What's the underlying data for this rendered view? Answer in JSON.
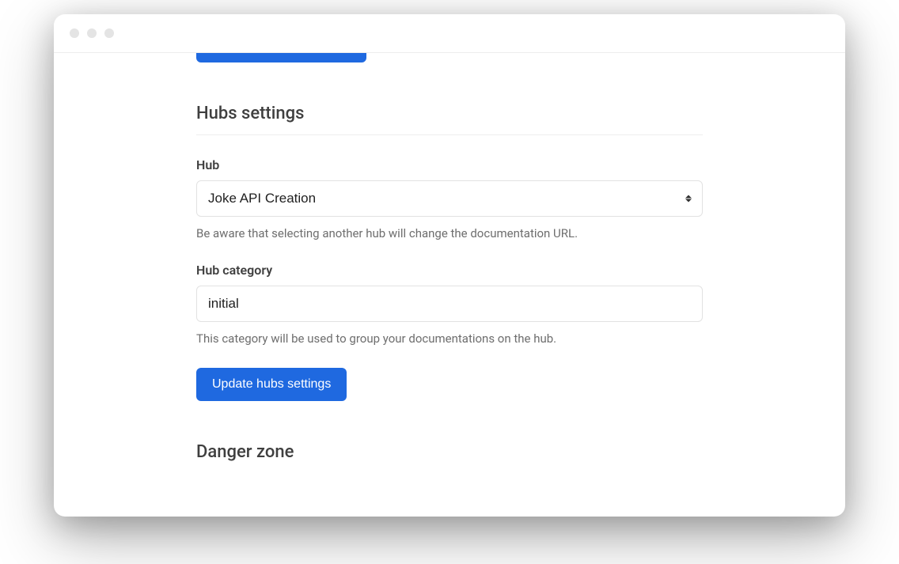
{
  "sections": {
    "hubs": {
      "heading": "Hubs settings",
      "hub_label": "Hub",
      "hub_value": "Joke API Creation",
      "hub_help": "Be aware that selecting another hub will change the documentation URL.",
      "category_label": "Hub category",
      "category_value": "initial",
      "category_help": "This category will be used to group your documentations on the hub.",
      "update_button": "Update hubs settings"
    },
    "danger": {
      "heading": "Danger zone"
    }
  }
}
